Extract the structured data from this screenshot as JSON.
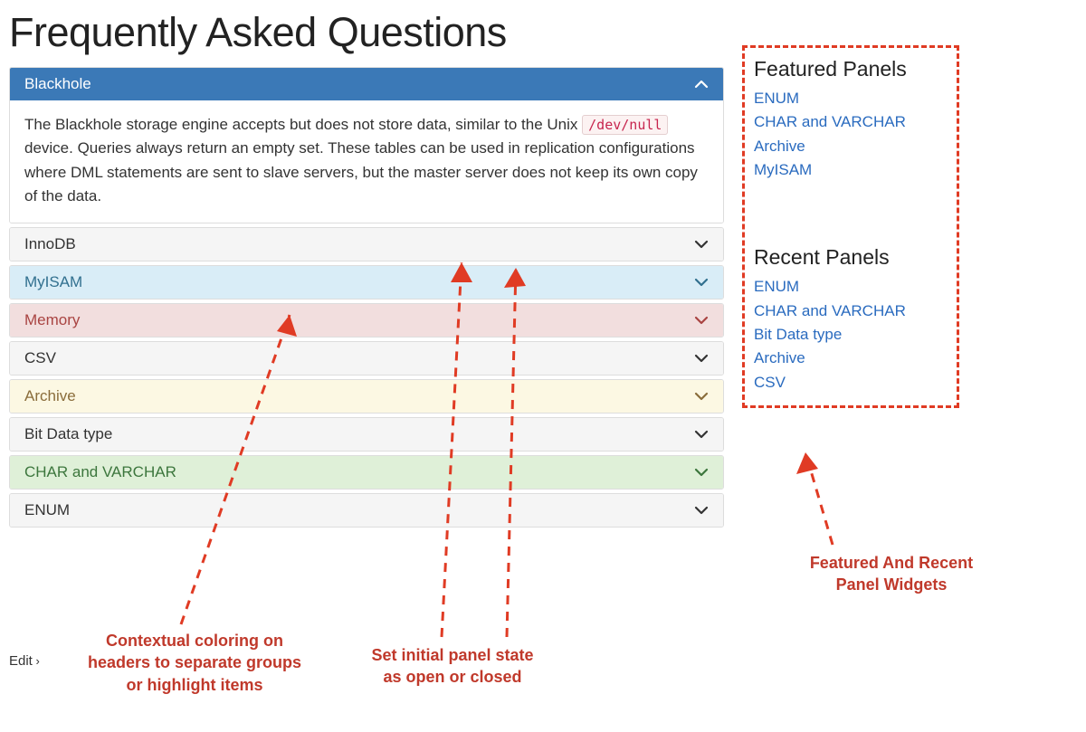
{
  "title": "Frequently Asked Questions",
  "open_panel": {
    "label": "Blackhole",
    "body_before_code": "The Blackhole storage engine accepts but does not store data, similar to the Unix ",
    "body_code": "/dev/null",
    "body_after_code": " device. Queries always return an empty set. These tables can be used in replication configurations where DML statements are sent to slave servers, but the master server does not keep its own copy of the data."
  },
  "panels": [
    {
      "label": "InnoDB",
      "variant": "default"
    },
    {
      "label": "MyISAM",
      "variant": "info"
    },
    {
      "label": "Memory",
      "variant": "danger"
    },
    {
      "label": "CSV",
      "variant": "default"
    },
    {
      "label": "Archive",
      "variant": "warning"
    },
    {
      "label": "Bit Data type",
      "variant": "default"
    },
    {
      "label": "CHAR and VARCHAR",
      "variant": "success"
    },
    {
      "label": "ENUM",
      "variant": "default"
    }
  ],
  "sidebar": {
    "featured_heading": "Featured Panels",
    "featured": [
      "ENUM",
      "CHAR and VARCHAR",
      "Archive",
      "MyISAM"
    ],
    "recent_heading": "Recent Panels",
    "recent": [
      "ENUM",
      "CHAR and VARCHAR",
      "Bit Data type",
      "Archive",
      "CSV"
    ]
  },
  "edit_label": "Edit",
  "callouts": {
    "left": "Contextual coloring on\nheaders to separate groups\nor highlight items",
    "middle": "Set initial panel state\nas open or closed",
    "right": "Featured And Recent\nPanel Widgets"
  },
  "chevron_colors": {
    "default": "#333333",
    "info": "#31708f",
    "danger": "#a94442",
    "warning": "#8a6d3b",
    "success": "#3c763d",
    "primary": "#ffffff"
  }
}
